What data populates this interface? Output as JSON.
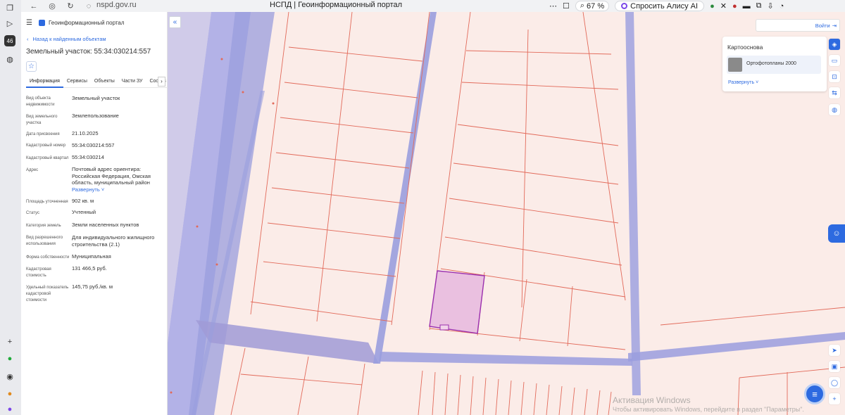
{
  "browser": {
    "address": "nspd.gov.ru",
    "page_title": "НСПД | Геоинформационный портал",
    "zoom": "67 %",
    "alice": "Спросить Алису AI",
    "sidebar_badge": "46"
  },
  "panel": {
    "portal_title": "Геоинформационный портал",
    "back_link": "Назад к найденным объектам",
    "object_title": "Земельный участок: 55:34:030214:557",
    "tabs": [
      "Информация",
      "Сервисы",
      "Объекты",
      "Части ЗУ",
      "Состав"
    ],
    "tab_more": "›",
    "rows": [
      {
        "label": "Вид объекта недвижимости",
        "value": "Земельный участок"
      },
      {
        "label": "Вид земельного участка",
        "value": "Землепользование"
      },
      {
        "label": "Дата присвоения",
        "value": "21.10.2025"
      },
      {
        "label": "Кадастровый номер",
        "value": "55:34:030214:557"
      },
      {
        "label": "Кадастровый квартал",
        "value": "55:34:030214"
      },
      {
        "label": "Адрес",
        "value": "Почтовый адрес ориентира: Российская Федерация, Омская область, муниципальный район"
      },
      {
        "label": "Площадь уточненная",
        "value": "902 кв. м"
      },
      {
        "label": "Статус",
        "value": "Учтенный"
      },
      {
        "label": "Категория земель",
        "value": "Земли населенных пунктов"
      },
      {
        "label": "Вид разрешенного использования",
        "value": "Для индивидуального жилищного строительства (2.1)"
      },
      {
        "label": "Форма собственности",
        "value": "Муниципальная"
      },
      {
        "label": "Кадастровая стоимость",
        "value": "131 466,5 руб."
      },
      {
        "label": "Удельный показатель кадастровой стоимости",
        "value": "145,75 руб./кв. м"
      }
    ],
    "address_expand": "Развернуть"
  },
  "map": {
    "login": "Войти",
    "basemap_title": "Картооснова",
    "basemap_item": "Ортофотопланы 2000",
    "basemap_expand": "Развернуть",
    "colors": {
      "background": "#fbece8",
      "parcel_line": "#e26a5a",
      "road": "#9a9ede",
      "selected_fill": "#eac0e0",
      "selected_stroke": "#9b2fae"
    }
  },
  "watermark": {
    "line1": "Активация Windows",
    "line2": "Чтобы активировать Windows, перейдите в раздел \"Параметры\"."
  }
}
